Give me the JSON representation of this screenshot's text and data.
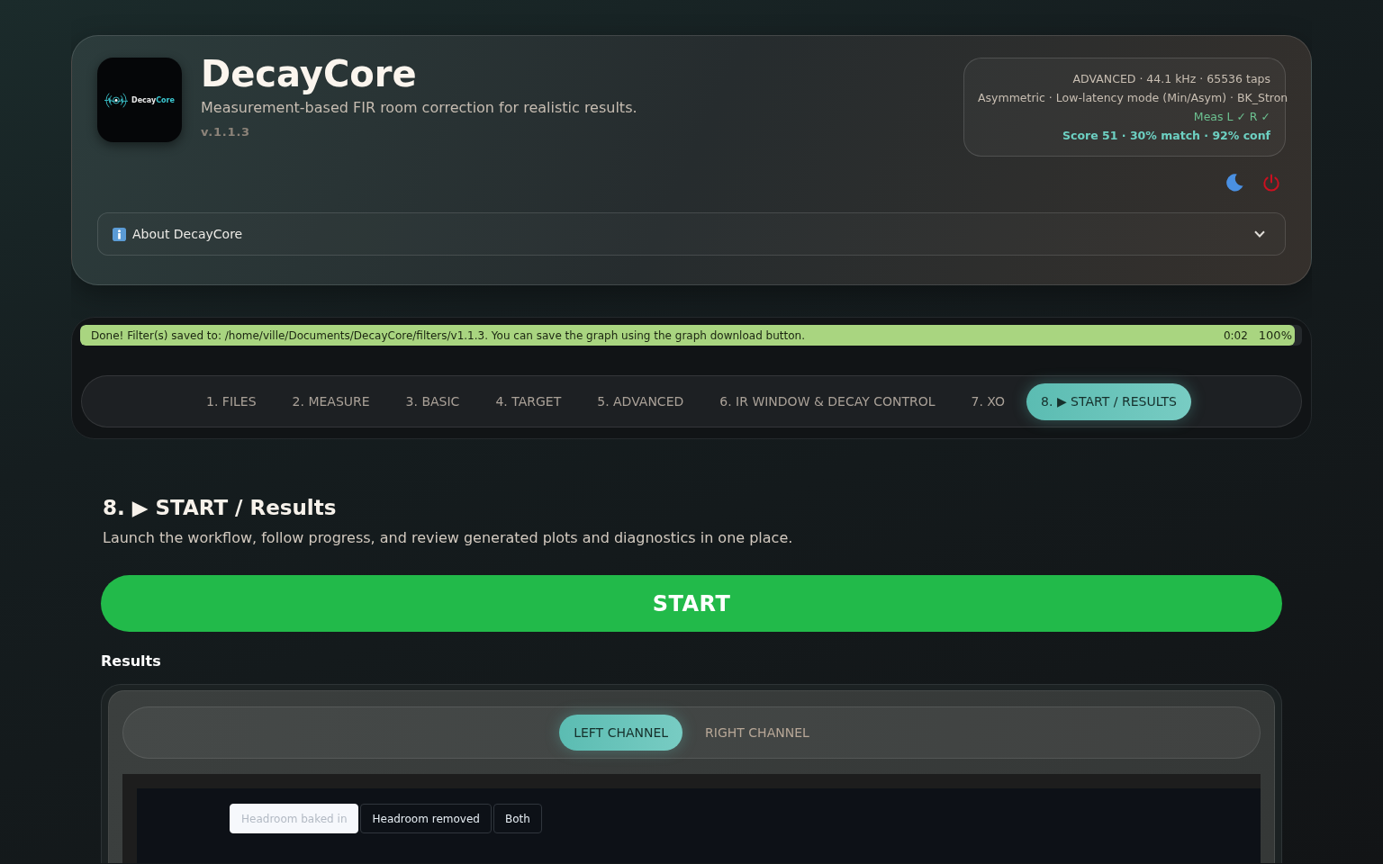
{
  "header": {
    "logo_text": [
      "Decay",
      "Core"
    ],
    "title": "DecayCore",
    "subtitle": "Measurement-based FIR room correction for realistic results.",
    "version": "v.1.1.3"
  },
  "status": [
    {
      "kind": "info",
      "text": "ADVANCED · 44.1 kHz · 65536 taps"
    },
    {
      "kind": "info",
      "text": "Asymmetric · Low-latency mode (Min/Asym) · BK_Stron"
    },
    {
      "kind": "ok",
      "text": "Meas L ✓ R ✓"
    },
    {
      "kind": "score",
      "text": "Score 51 · 30% match · 92% conf"
    }
  ],
  "about": {
    "label": "About DecayCore",
    "expanded": false
  },
  "progress": {
    "message": "Done! Filter(s) saved to: /home/ville/Documents/DecayCore/filters/v1.1.3. You can save the graph using the graph download button.",
    "elapsed": "0:02",
    "percent": "100%",
    "level": 1
  },
  "tabs": [
    {
      "label": "1. FILES",
      "selected": false
    },
    {
      "label": "2. MEASURE",
      "selected": false
    },
    {
      "label": "3. BASIC",
      "selected": false
    },
    {
      "label": "4. TARGET",
      "selected": false
    },
    {
      "label": "5. ADVANCED",
      "selected": false
    },
    {
      "label": "6. IR WINDOW & DECAY CONTROL",
      "selected": false
    },
    {
      "label": "7. XO",
      "selected": false
    },
    {
      "label": "8. ▶ START / RESULTS",
      "selected": true
    }
  ],
  "section": {
    "title": "8. ▶ START / Results",
    "description": "Launch the workflow, follow progress, and review generated plots and diagnostics in one place.",
    "start_button": "START"
  },
  "results": {
    "title": "Results",
    "channel_tabs": [
      {
        "label": "LEFT CHANNEL",
        "selected": true
      },
      {
        "label": "RIGHT CHANNEL",
        "selected": false
      }
    ],
    "plot_modes": [
      {
        "label": "Headroom baked in",
        "selected": true
      },
      {
        "label": "Headroom removed",
        "selected": false
      },
      {
        "label": "Both",
        "selected": false
      }
    ]
  }
}
